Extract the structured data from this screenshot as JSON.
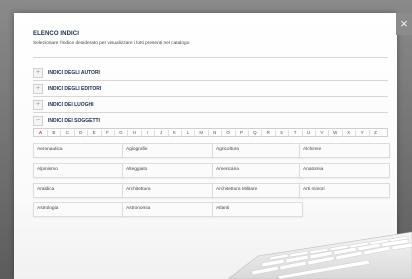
{
  "window": {
    "close_glyph": "×"
  },
  "header": {
    "title": "ELENCO INDICI",
    "subtitle": "Selezionare l'indice desiderato per visualizzare i lotti presenti nel catalogo"
  },
  "sections": [
    {
      "toggle": "+",
      "label": "INDICI DEGLI AUTORI"
    },
    {
      "toggle": "+",
      "label": "INDICI DEGLI EDITORI"
    },
    {
      "toggle": "+",
      "label": "INDICI DEI LUOGHI"
    },
    {
      "toggle": "−",
      "label": "INDICI DEI SOGGETTI"
    }
  ],
  "alphabet": {
    "letters": [
      "A",
      "B",
      "C",
      "D",
      "E",
      "F",
      "G",
      "H",
      "I",
      "J",
      "K",
      "L",
      "M",
      "N",
      "O",
      "P",
      "Q",
      "R",
      "S",
      "T",
      "U",
      "V",
      "W",
      "X",
      "Y",
      "Z"
    ],
    "active": "A"
  },
  "subjects": [
    [
      "Aeronautica",
      "Agiografie",
      "Agricoltura",
      "Alchimie"
    ],
    [
      "Alpinismo",
      "Alteggiato",
      "Americana",
      "Anatomia"
    ],
    [
      "Araldica",
      "Architettura",
      "Architettura Militare",
      "Arti minori"
    ],
    [
      "Astrologia",
      "Astronomia",
      "Atlanti",
      ""
    ]
  ]
}
